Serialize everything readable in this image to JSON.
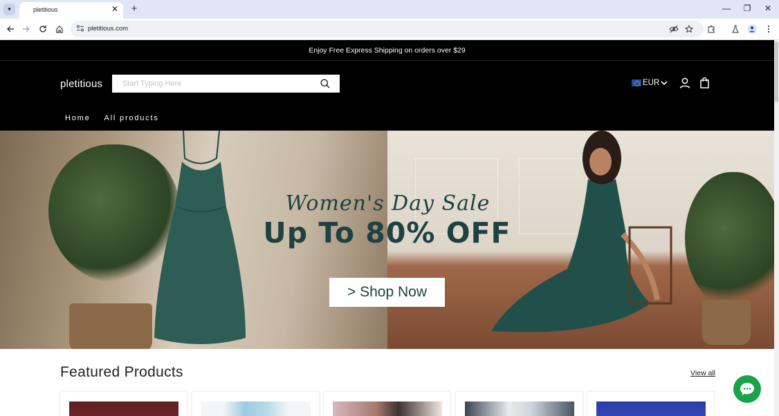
{
  "browser": {
    "tab_title": "pletitious",
    "url": "pletitious.com"
  },
  "store": {
    "announcement": "Enjoy Free Express Shipping on orders over $29",
    "logo": "pletitious",
    "search_placeholder": "Start Typing Here",
    "currency": "EUR",
    "nav": [
      "Home",
      "All products"
    ]
  },
  "hero": {
    "script_title": "Women's Day Sale",
    "title": "Up To 80% OFF",
    "button": "> Shop Now"
  },
  "featured": {
    "title": "Featured Products",
    "view_all": "View all"
  },
  "colors": {
    "accent": "#1e4242",
    "header_bg": "#000000",
    "chat": "#16a34a"
  }
}
